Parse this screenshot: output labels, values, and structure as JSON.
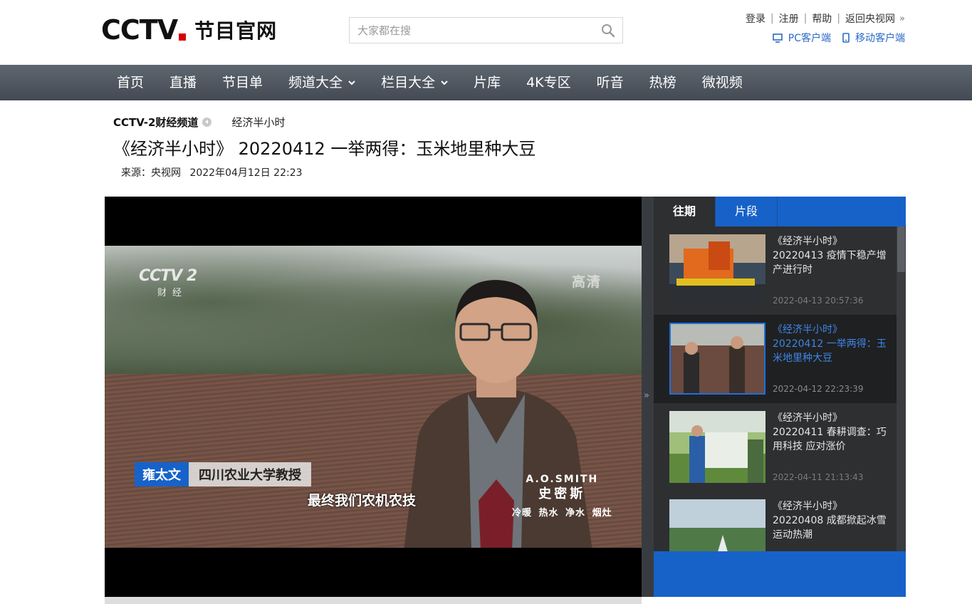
{
  "header": {
    "logo_text": "CCTV",
    "logo_sub": "节目官网",
    "search_placeholder": "大家都在搜",
    "links": [
      "登录",
      "注册",
      "帮助",
      "返回央视网"
    ],
    "client_links": [
      "PC客户端",
      "移动客户端"
    ]
  },
  "nav": {
    "items": [
      {
        "label": "首页",
        "dropdown": false
      },
      {
        "label": "直播",
        "dropdown": false
      },
      {
        "label": "节目单",
        "dropdown": false
      },
      {
        "label": "频道大全",
        "dropdown": true
      },
      {
        "label": "栏目大全",
        "dropdown": true
      },
      {
        "label": "片库",
        "dropdown": false
      },
      {
        "label": "4K专区",
        "dropdown": false
      },
      {
        "label": "听音",
        "dropdown": false
      },
      {
        "label": "热榜",
        "dropdown": false
      },
      {
        "label": "微视频",
        "dropdown": false
      }
    ]
  },
  "breadcrumb": {
    "channel": "CCTV-2财经频道",
    "column": "经济半小时"
  },
  "article": {
    "title": "《经济半小时》 20220412 一举两得：玉米地里种大豆",
    "source": "来源：央视网",
    "datetime": "2022年04月12日 22:23"
  },
  "player": {
    "channel_logo": "CCTV 2",
    "channel_logo_sub": "财经",
    "hd_badge": "高清",
    "lower_third_name": "雍太文",
    "lower_third_role": "四川农业大学教授",
    "subtitle": "最终我们农机农技",
    "sponsor_line1": "A.O.SMITH",
    "sponsor_line2": "史密斯",
    "sponsor_line3": "冷暖 热水 净水 烟灶"
  },
  "sidebar": {
    "tabs": [
      {
        "label": "往期",
        "active": true
      },
      {
        "label": "片段",
        "active": false
      }
    ],
    "items": [
      {
        "title": "《经济半小时》 20220413 疫情下稳产增产进行时",
        "time": "2022-04-13 20:57:36",
        "active": false
      },
      {
        "title": "《经济半小时》 20220412 一举两得：玉米地里种大豆",
        "time": "2022-04-12 22:23:39",
        "active": true
      },
      {
        "title": "《经济半小时》 20220411 春耕调查：巧用科技 应对涨价",
        "time": "2022-04-11 21:13:43",
        "active": false
      },
      {
        "title": "《经济半小时》 20220408 成都掀起冰雪运动热潮",
        "time": "",
        "active": false
      }
    ]
  },
  "colors": {
    "nav_bg": "#4f5660",
    "accent_blue": "#1762c9",
    "sidebar_bg": "#2d2f31",
    "active_title": "#3d86e6",
    "logo_red": "#d40000"
  }
}
